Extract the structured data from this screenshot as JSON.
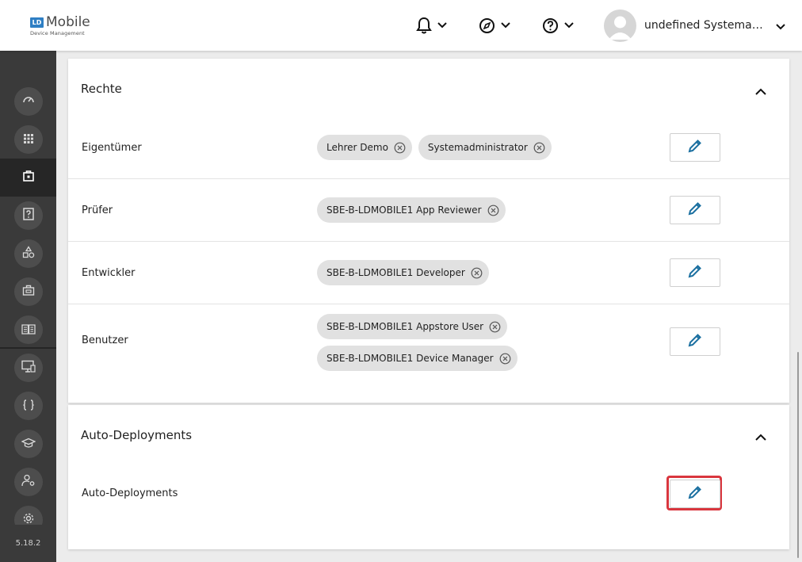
{
  "header": {
    "logo_badge": "LD",
    "logo_title": "Mobile",
    "logo_subtitle": "Device Management",
    "user_name": "undefined Systemadministrator"
  },
  "sidebar": {
    "items": [
      "dashboard-icon",
      "apps-grid-icon",
      "app-package-icon",
      "help-box-icon",
      "shapes-icon",
      "briefcase-icon",
      "book-icon",
      "monitor-icon",
      "braces-icon",
      "graduation-cap-icon",
      "user-settings-icon",
      "gear-icon"
    ],
    "active_index": 2,
    "version": "5.18.2"
  },
  "rights": {
    "title": "Rechte",
    "rows": [
      {
        "label": "Eigentümer",
        "chips": [
          "Lehrer Demo",
          "Systemadministrator"
        ]
      },
      {
        "label": "Prüfer",
        "chips": [
          "SBE-B-LDMOBILE1 App Reviewer"
        ]
      },
      {
        "label": "Entwickler",
        "chips": [
          "SBE-B-LDMOBILE1 Developer"
        ]
      },
      {
        "label": "Benutzer",
        "chips": [
          "SBE-B-LDMOBILE1 Appstore User",
          "SBE-B-LDMOBILE1 Device Manager"
        ]
      }
    ]
  },
  "auto": {
    "title": "Auto-Deployments",
    "row_label": "Auto-Deployments"
  },
  "colors": {
    "accent": "#1a6fa0",
    "highlight": "#d9363e",
    "sidebar": "#3a3a3a"
  }
}
